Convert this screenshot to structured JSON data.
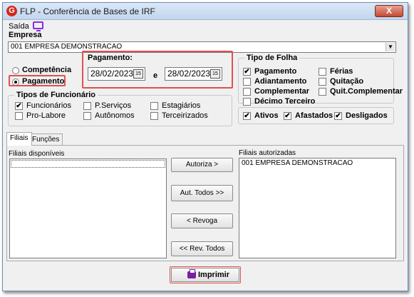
{
  "window": {
    "title": "FLP - Conferência de Bases de IRF",
    "app_icon": "G",
    "close_label": "X"
  },
  "menu": {
    "saida_label": "Saída",
    "monitor_icon": "monitor-icon"
  },
  "empresa": {
    "label": "Empresa",
    "value": "001 EMPRESA DEMONSTRACAO"
  },
  "periodo": {
    "competencia_label": "Competência",
    "pagamento_label": "Pagamento",
    "selected": "Pagamento"
  },
  "pagamento": {
    "label": "Pagamento:",
    "date_from": "28/02/2023",
    "date_to": "28/02/2023",
    "separator": "e",
    "cal_icon_text": "15"
  },
  "tipo_folha": {
    "label": "Tipo de Folha",
    "items": [
      {
        "label": "Pagamento",
        "checked": true
      },
      {
        "label": "Adiantamento",
        "checked": false
      },
      {
        "label": "Complementar",
        "checked": false
      },
      {
        "label": "Décimo Terceiro",
        "checked": false
      },
      {
        "label": "Férias",
        "checked": false
      },
      {
        "label": "Quitação",
        "checked": false
      },
      {
        "label": "Quit.Complementar",
        "checked": false
      }
    ]
  },
  "tipos_funcionario": {
    "label": "Tipos de Funcionário",
    "items": [
      {
        "label": "Funcionários",
        "checked": true
      },
      {
        "label": "Pro-Labore",
        "checked": false
      },
      {
        "label": "P.Serviços",
        "checked": false
      },
      {
        "label": "Autônomos",
        "checked": false
      },
      {
        "label": "Estagiários",
        "checked": false
      },
      {
        "label": "Terceirizados",
        "checked": false
      }
    ]
  },
  "situacao": {
    "items": [
      {
        "label": "Ativos",
        "checked": true
      },
      {
        "label": "Afastados",
        "checked": true
      },
      {
        "label": "Desligados",
        "checked": true
      }
    ]
  },
  "tabs": [
    {
      "label": "Filiais",
      "active": true
    },
    {
      "label": "Funções",
      "active": false
    }
  ],
  "filiais": {
    "disponiveis_label": "Filiais disponíveis",
    "disponiveis": [],
    "autorizadas_label": "Filiais autorizadas",
    "autorizadas": [
      "001 EMPRESA DEMONSTRACAO"
    ]
  },
  "buttons": {
    "autoriza": "Autoriza >",
    "aut_todos": "Aut. Todos >>",
    "revoga": "< Revoga",
    "rev_todos": "<< Rev. Todos",
    "imprimir": "Imprimir"
  },
  "check_mark": "✔"
}
